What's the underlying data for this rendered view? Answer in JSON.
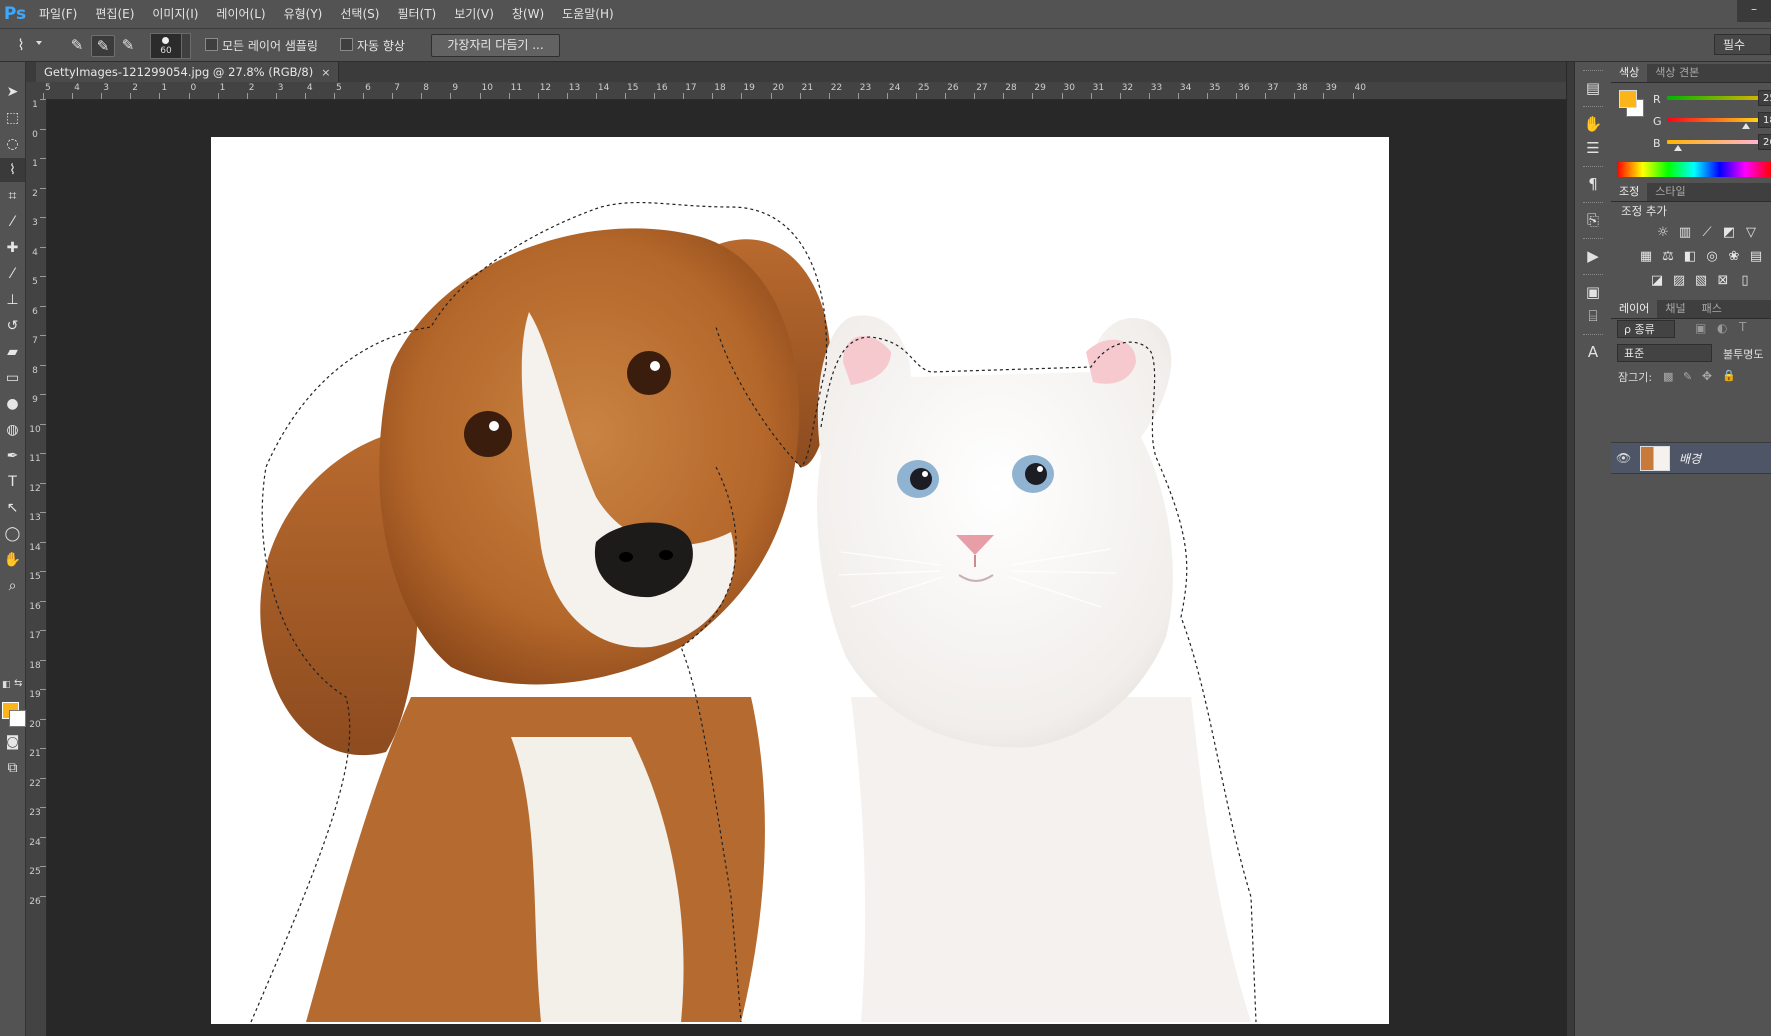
{
  "app": {
    "logo": "Ps"
  },
  "menu": [
    "파일(F)",
    "편집(E)",
    "이미지(I)",
    "레이어(L)",
    "유형(Y)",
    "선택(S)",
    "필터(T)",
    "보기(V)",
    "창(W)",
    "도움말(H)"
  ],
  "window_controls": {
    "minimize": "–"
  },
  "options": {
    "brush_size": "60",
    "sample_all_layers": "모든 레이어 샘플링",
    "auto_enhance": "자동 향상",
    "refine_edge": "가장자리 다듬기 ...",
    "workspace": "필수"
  },
  "document": {
    "tab_title": "GettyImages-121299054.jpg @ 27.8% (RGB/8)",
    "close": "×"
  },
  "ruler": {
    "top": [
      "5",
      "4",
      "3",
      "2",
      "1",
      "0",
      "1",
      "2",
      "3",
      "4",
      "5",
      "6",
      "7",
      "8",
      "9",
      "10",
      "11",
      "12",
      "13",
      "14",
      "15",
      "16",
      "17",
      "18",
      "19",
      "20",
      "21",
      "22",
      "23",
      "24",
      "25",
      "26",
      "27",
      "28",
      "29",
      "30",
      "31",
      "32",
      "33",
      "34",
      "35",
      "36",
      "37",
      "38",
      "39",
      "40"
    ],
    "left": [
      "1",
      "0",
      "1",
      "2",
      "3",
      "4",
      "5",
      "6",
      "7",
      "8",
      "9",
      "10",
      "11",
      "12",
      "13",
      "14",
      "15",
      "16",
      "17",
      "18",
      "19",
      "20",
      "21",
      "22",
      "23",
      "24",
      "25",
      "26"
    ]
  },
  "colors": {
    "foreground": "#fbb41a",
    "background": "#ffffff"
  },
  "panels": {
    "color": {
      "tabs": [
        "색상",
        "색상 견본"
      ],
      "channels": [
        {
          "label": "R",
          "value": "25",
          "level": 0.98
        },
        {
          "label": "G",
          "value": "18",
          "level": 0.71
        },
        {
          "label": "B",
          "value": "26",
          "level": 0.1
        }
      ]
    },
    "adjustments": {
      "tabs": [
        "조정",
        "스타일"
      ],
      "heading": "조정 추가"
    },
    "layers": {
      "tabs": [
        "레이어",
        "채널",
        "패스"
      ],
      "filter_kind": "ρ 종류",
      "blend_mode": "표준",
      "opacity_label": "불투명도",
      "lock_label": "잠그기:",
      "layer_name": "배경"
    }
  }
}
